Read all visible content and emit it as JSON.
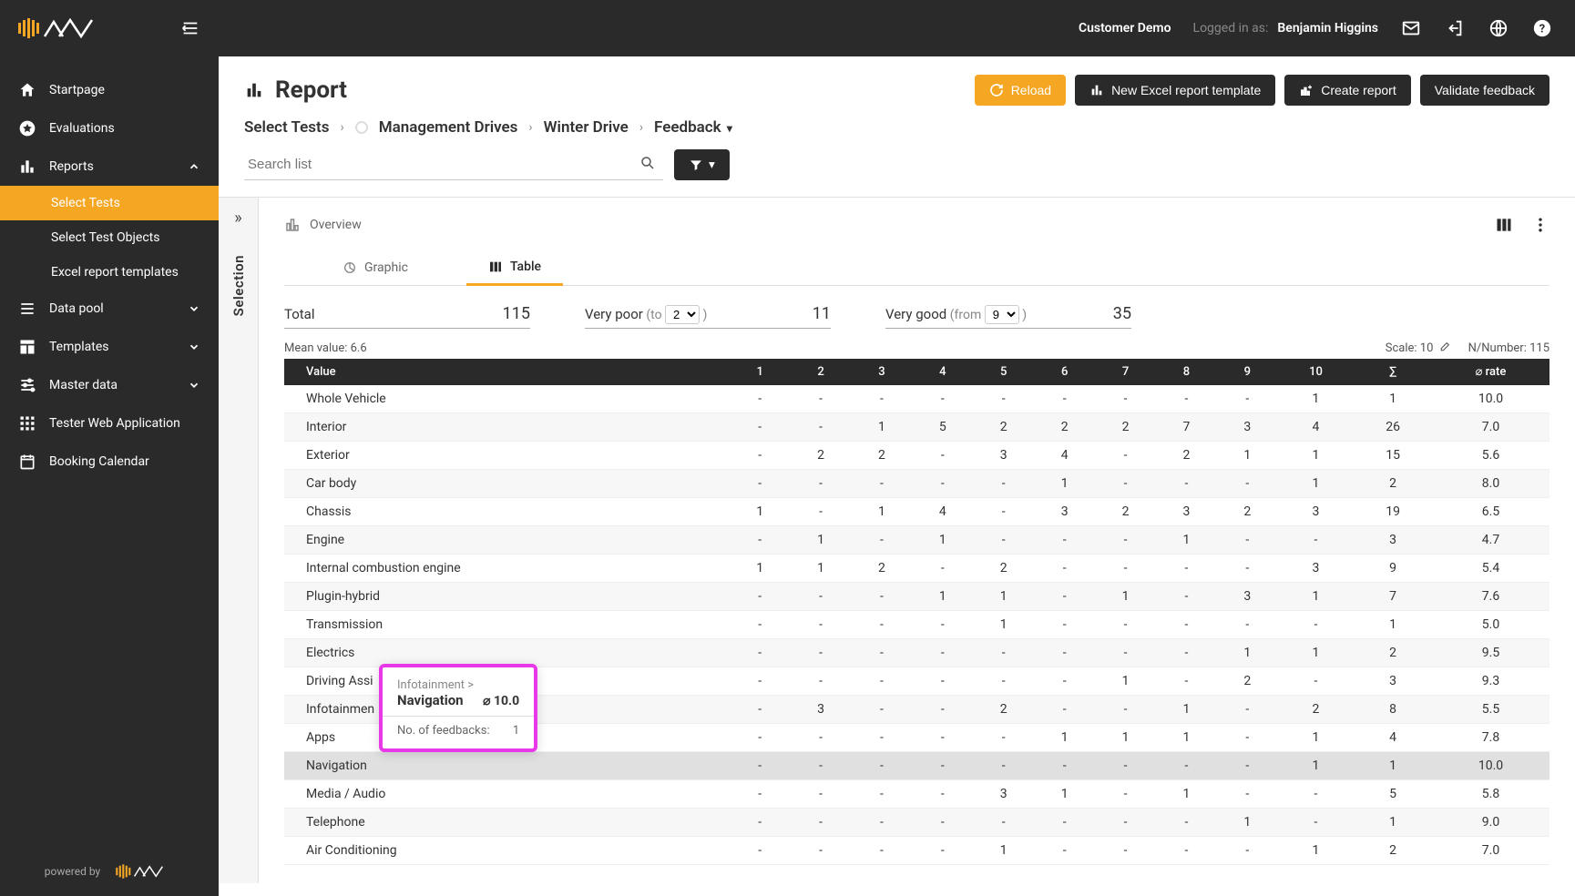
{
  "header": {
    "customer": "Customer Demo",
    "logged_in_label": "Logged in as:",
    "user": "Benjamin Higgins"
  },
  "sidebar": {
    "items": [
      {
        "label": "Startpage"
      },
      {
        "label": "Evaluations"
      },
      {
        "label": "Reports"
      },
      {
        "label": "Select Tests"
      },
      {
        "label": "Select Test Objects"
      },
      {
        "label": "Excel report templates"
      },
      {
        "label": "Data pool"
      },
      {
        "label": "Templates"
      },
      {
        "label": "Master data"
      },
      {
        "label": "Tester Web Application"
      },
      {
        "label": "Booking Calendar"
      }
    ],
    "powered": "powered by"
  },
  "page": {
    "title": "Report",
    "actions": {
      "reload": "Reload",
      "new_excel": "New Excel report template",
      "create_report": "Create report",
      "validate": "Validate feedback"
    },
    "breadcrumb": [
      "Select Tests",
      "Management Drives",
      "Winter Drive",
      "Feedback"
    ],
    "search_placeholder": "Search list"
  },
  "report": {
    "selection_label": "Selection",
    "overview_label": "Overview",
    "tabs": {
      "graphic": "Graphic",
      "table": "Table"
    },
    "stats": {
      "total_label": "Total",
      "total_val": "115",
      "poor_label": "Very poor",
      "poor_to": "(to",
      "poor_select": "2",
      "poor_close": ")",
      "poor_val": "11",
      "good_label": "Very good",
      "good_from": "(from",
      "good_select": "9",
      "good_close": ")",
      "good_val": "35"
    },
    "meta": {
      "mean": "Mean value: 6.6",
      "scale": "Scale: 10",
      "number": "N/Number: 115"
    },
    "columns": [
      "Value",
      "1",
      "2",
      "3",
      "4",
      "5",
      "6",
      "7",
      "8",
      "9",
      "10",
      "∑",
      "⌀ rate"
    ],
    "rows": [
      {
        "name": "Whole Vehicle",
        "v": [
          "-",
          "-",
          "-",
          "-",
          "-",
          "-",
          "-",
          "-",
          "-",
          "1",
          "1",
          "10.0"
        ]
      },
      {
        "name": "Interior",
        "v": [
          "-",
          "-",
          "1",
          "5",
          "2",
          "2",
          "2",
          "7",
          "3",
          "4",
          "26",
          "7.0"
        ]
      },
      {
        "name": "Exterior",
        "v": [
          "-",
          "2",
          "2",
          "-",
          "3",
          "4",
          "-",
          "2",
          "1",
          "1",
          "15",
          "5.6"
        ]
      },
      {
        "name": "Car body",
        "v": [
          "-",
          "-",
          "-",
          "-",
          "-",
          "1",
          "-",
          "-",
          "-",
          "1",
          "2",
          "8.0"
        ]
      },
      {
        "name": "Chassis",
        "v": [
          "1",
          "-",
          "1",
          "4",
          "-",
          "3",
          "2",
          "3",
          "2",
          "3",
          "19",
          "6.5"
        ]
      },
      {
        "name": "Engine",
        "v": [
          "-",
          "1",
          "-",
          "1",
          "-",
          "-",
          "-",
          "1",
          "-",
          "-",
          "3",
          "4.7"
        ]
      },
      {
        "name": "Internal combustion engine",
        "v": [
          "1",
          "1",
          "2",
          "-",
          "2",
          "-",
          "-",
          "-",
          "-",
          "3",
          "9",
          "5.4"
        ]
      },
      {
        "name": "Plugin-hybrid",
        "v": [
          "-",
          "-",
          "-",
          "1",
          "1",
          "-",
          "1",
          "-",
          "3",
          "1",
          "7",
          "7.6"
        ]
      },
      {
        "name": "Transmission",
        "v": [
          "-",
          "-",
          "-",
          "-",
          "1",
          "-",
          "-",
          "-",
          "-",
          "-",
          "1",
          "5.0"
        ]
      },
      {
        "name": "Electrics",
        "v": [
          "-",
          "-",
          "-",
          "-",
          "-",
          "-",
          "-",
          "-",
          "1",
          "1",
          "2",
          "9.5"
        ]
      },
      {
        "name": "Driving Assi",
        "v": [
          "-",
          "-",
          "-",
          "-",
          "-",
          "-",
          "1",
          "-",
          "2",
          "-",
          "3",
          "9.3"
        ]
      },
      {
        "name": "Infotainmen",
        "v": [
          "-",
          "3",
          "-",
          "-",
          "2",
          "-",
          "-",
          "1",
          "-",
          "2",
          "8",
          "5.5"
        ]
      },
      {
        "name": "Apps",
        "v": [
          "-",
          "-",
          "-",
          "-",
          "-",
          "1",
          "1",
          "1",
          "-",
          "1",
          "4",
          "7.8"
        ]
      },
      {
        "name": "Navigation",
        "v": [
          "-",
          "-",
          "-",
          "-",
          "-",
          "-",
          "-",
          "-",
          "-",
          "1",
          "1",
          "10.0"
        ],
        "highlighted": true
      },
      {
        "name": "Media / Audio",
        "v": [
          "-",
          "-",
          "-",
          "-",
          "3",
          "1",
          "-",
          "1",
          "-",
          "-",
          "5",
          "5.8"
        ]
      },
      {
        "name": "Telephone",
        "v": [
          "-",
          "-",
          "-",
          "-",
          "-",
          "-",
          "-",
          "-",
          "1",
          "-",
          "1",
          "9.0"
        ]
      },
      {
        "name": "Air Conditioning",
        "v": [
          "-",
          "-",
          "-",
          "-",
          "1",
          "-",
          "-",
          "-",
          "-",
          "1",
          "2",
          "7.0"
        ]
      }
    ]
  },
  "tooltip": {
    "path": "Infotainment >",
    "name": "Navigation",
    "rate": "⌀ 10.0",
    "feedback_label": "No. of feedbacks:",
    "feedback_val": "1"
  }
}
